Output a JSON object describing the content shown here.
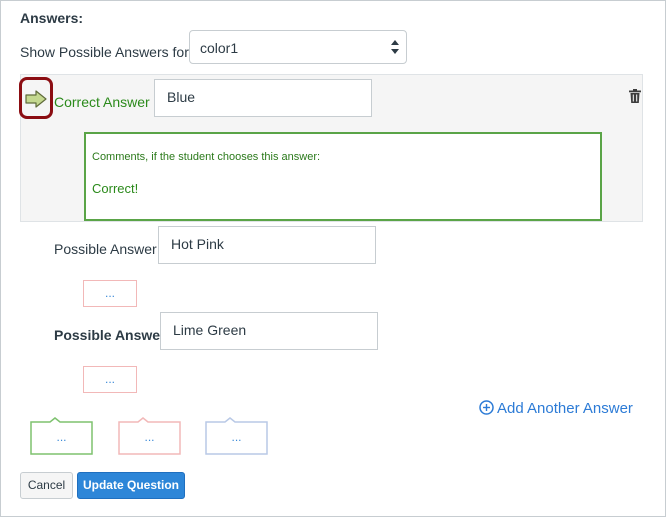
{
  "header": {
    "title": "Answers:",
    "show_label": "Show Possible Answers for",
    "select_value": "color1"
  },
  "correct_answer": {
    "label": "Correct Answer",
    "value": "Blue",
    "comments_hint": "Comments, if the student chooses this answer:",
    "comments_text": "Correct!"
  },
  "possible_answers": [
    {
      "label": "Possible Answer",
      "value": "Hot Pink",
      "comment_placeholder": "..."
    },
    {
      "label": "Possible Answer",
      "value": "Lime Green",
      "comment_placeholder": "..."
    }
  ],
  "add_answer": {
    "label": "Add Another Answer"
  },
  "general_comments": [
    {
      "kind": "correct",
      "placeholder": "..."
    },
    {
      "kind": "incorrect",
      "placeholder": "..."
    },
    {
      "kind": "neutral",
      "placeholder": "..."
    }
  ],
  "buttons": {
    "cancel": "Cancel",
    "update": "Update Question"
  },
  "colors": {
    "correct_green": "#2b8a1b",
    "highlight_red": "#8b0d12",
    "link_blue": "#2c7bd6",
    "button_blue": "#2d86d8"
  },
  "icons": {
    "correct_arrow": "arrow-right-icon",
    "delete": "trash-icon",
    "add": "plus-circle-icon",
    "select": "up-down-arrows-icon"
  }
}
